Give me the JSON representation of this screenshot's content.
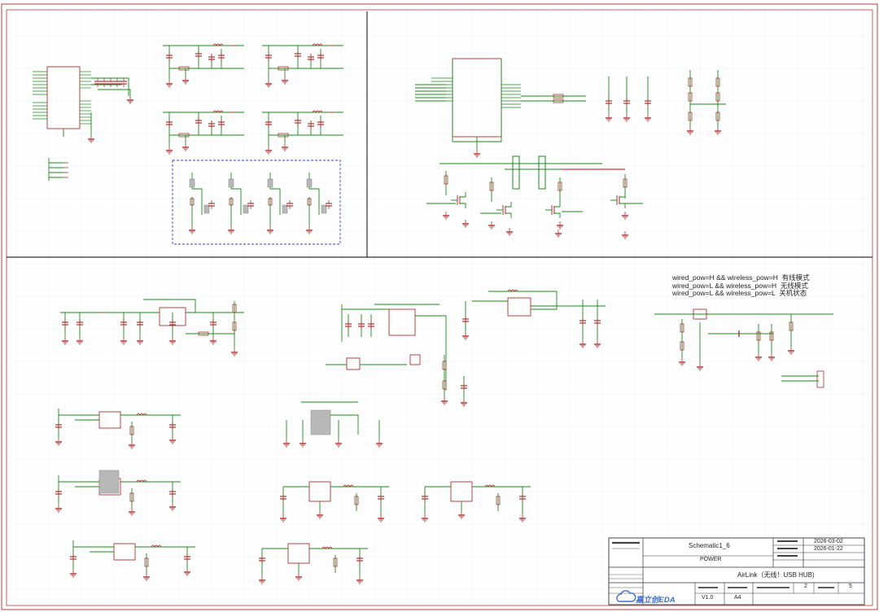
{
  "notes": [
    "wired_pow=H && wireless_pow=H  有线模式",
    "wired_pow=L && wireless_pow=H  无线模式",
    "wired_pow=L && wireless_pow=L  关机状态"
  ],
  "title_block": {
    "schematic_name": "Schematic1_6",
    "sheet_name": "POWER",
    "project_title": "AirLink（无线！USB HUB)",
    "update_date": "2026-03-02",
    "create_date": "2026-01-22",
    "version": "V1.0",
    "paper_size": "A4",
    "page": "2",
    "page_total": "5",
    "logo_text": "嘉立创EDA"
  },
  "colors": {
    "border": "#c13b3b",
    "wire": "#1a8a1a",
    "component": "#b03030",
    "bus_highlight": "#e03030",
    "dashed_group": "#3a3ad0",
    "divider": "#333333",
    "logo": "#3a6fd0"
  }
}
